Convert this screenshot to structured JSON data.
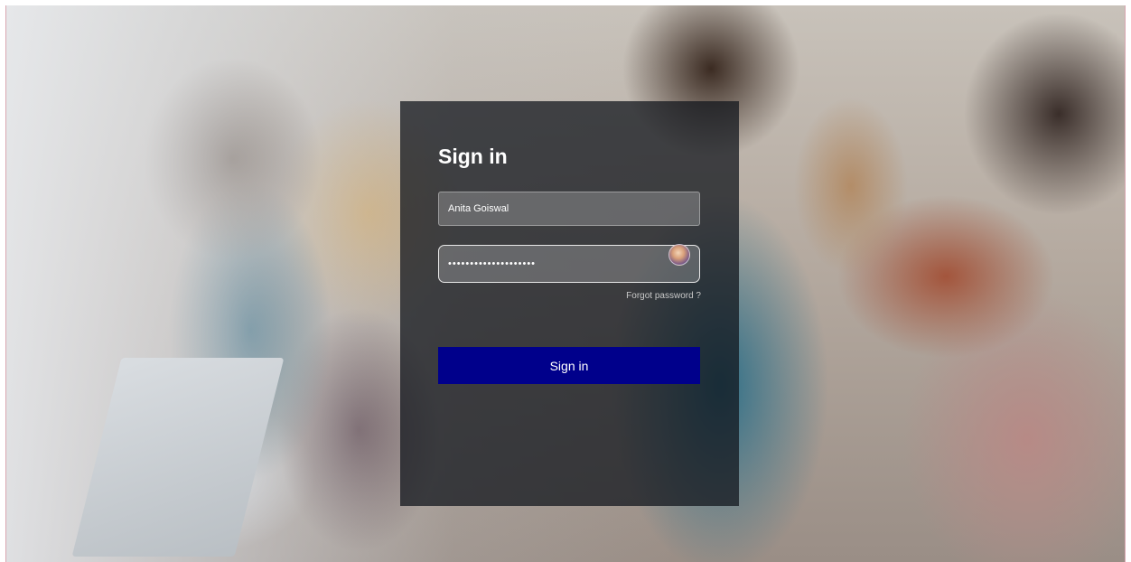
{
  "login": {
    "title": "Sign in",
    "username_value": "Anita Goiswal",
    "password_value": "••••••••••••••••••••",
    "forgot_label": "Forgot password ?",
    "submit_label": "Sign in"
  },
  "colors": {
    "button_bg": "#00008b",
    "panel_bg": "rgba(18,22,28,0.74)",
    "text": "#ffffff"
  },
  "icons": {
    "password_field": "avatar-icon"
  }
}
